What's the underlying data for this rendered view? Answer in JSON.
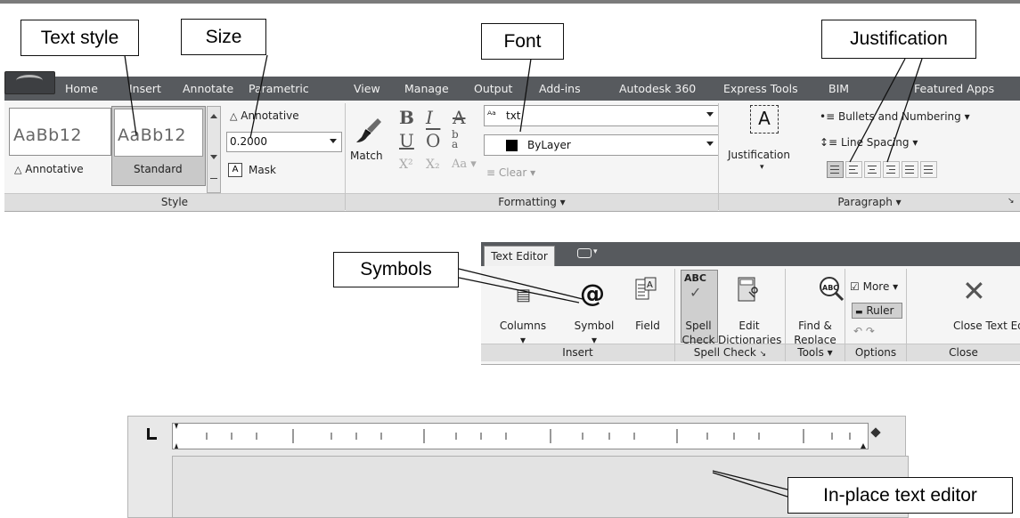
{
  "callouts": {
    "text_style": "Text style",
    "size": "Size",
    "font": "Font",
    "justification": "Justification",
    "symbols": "Symbols",
    "inplace": "In-place text editor"
  },
  "tabs": [
    "Home",
    "Insert",
    "Annotate",
    "Parametric",
    "View",
    "Manage",
    "Output",
    "Add-ins",
    "Autodesk 360",
    "Express Tools",
    "BIM",
    "Featured Apps"
  ],
  "style_panel": {
    "preview_text": "AaBb12",
    "style1": "Annotative",
    "style2": "Standard",
    "annotative_label": "Annotative",
    "size_value": "0.2000",
    "mask_label": "Mask",
    "footer": "Style"
  },
  "formatting_panel": {
    "match_label": "Match",
    "font_value": "txt",
    "color_value": "ByLayer",
    "clear_label": "Clear",
    "footer": "Formatting"
  },
  "paragraph_panel": {
    "justification_label": "Justification",
    "bullets_label": "Bullets and Numbering",
    "line_spacing_label": "Line Spacing",
    "footer": "Paragraph"
  },
  "text_editor": {
    "tab_label": "Text Editor",
    "columns": "Columns",
    "symbol": "Symbol",
    "field": "Field",
    "spell_check": "Spell Check",
    "edit_dictionaries": "Edit Dictionaries",
    "find_replace": "Find & Replace",
    "more": "More",
    "ruler": "Ruler",
    "close_editor": "Close Text Edito",
    "footers": [
      "Insert",
      "Spell Check",
      "Tools",
      "Options",
      "Close"
    ]
  },
  "colors": {
    "tab_bar": "#575a5e",
    "ribbon": "#f5f5f5",
    "selected_style": "#c7c7c7"
  }
}
